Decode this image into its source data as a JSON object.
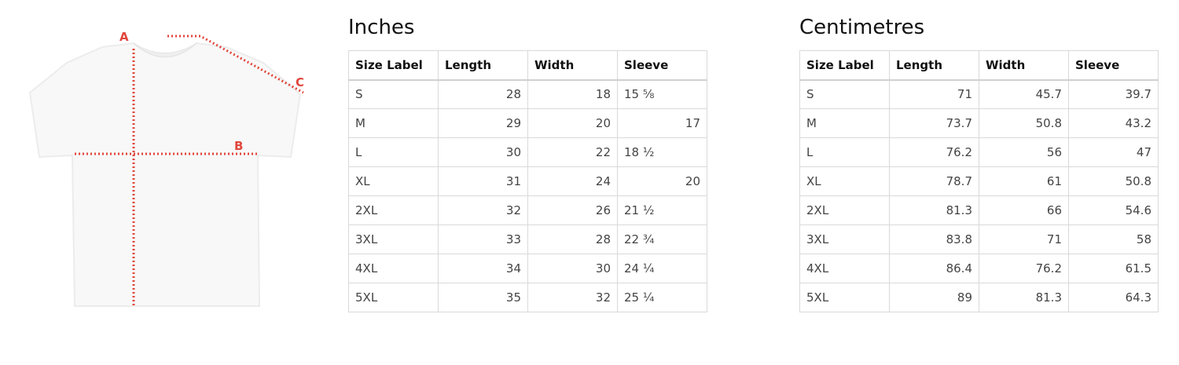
{
  "diagram": {
    "labels": {
      "a": "A",
      "b": "B",
      "c": "C"
    },
    "colors": {
      "marker": "#e0463c",
      "shirt": "#f8f8f8"
    }
  },
  "inches": {
    "title": "Inches",
    "headers": [
      "Size Label",
      "Length",
      "Width",
      "Sleeve"
    ],
    "rows": [
      [
        "S",
        "28",
        "18",
        "15 ⅝"
      ],
      [
        "M",
        "29",
        "20",
        "17"
      ],
      [
        "L",
        "30",
        "22",
        "18 ½"
      ],
      [
        "XL",
        "31",
        "24",
        "20"
      ],
      [
        "2XL",
        "32",
        "26",
        "21 ½"
      ],
      [
        "3XL",
        "33",
        "28",
        "22 ¾"
      ],
      [
        "4XL",
        "34",
        "30",
        "24 ¼"
      ],
      [
        "5XL",
        "35",
        "32",
        "25 ¼"
      ]
    ]
  },
  "centimetres": {
    "title": "Centimetres",
    "headers": [
      "Size Label",
      "Length",
      "Width",
      "Sleeve"
    ],
    "rows": [
      [
        "S",
        "71",
        "45.7",
        "39.7"
      ],
      [
        "M",
        "73.7",
        "50.8",
        "43.2"
      ],
      [
        "L",
        "76.2",
        "56",
        "47"
      ],
      [
        "XL",
        "78.7",
        "61",
        "50.8"
      ],
      [
        "2XL",
        "81.3",
        "66",
        "54.6"
      ],
      [
        "3XL",
        "83.8",
        "71",
        "58"
      ],
      [
        "4XL",
        "86.4",
        "76.2",
        "61.5"
      ],
      [
        "5XL",
        "89",
        "81.3",
        "64.3"
      ]
    ]
  }
}
